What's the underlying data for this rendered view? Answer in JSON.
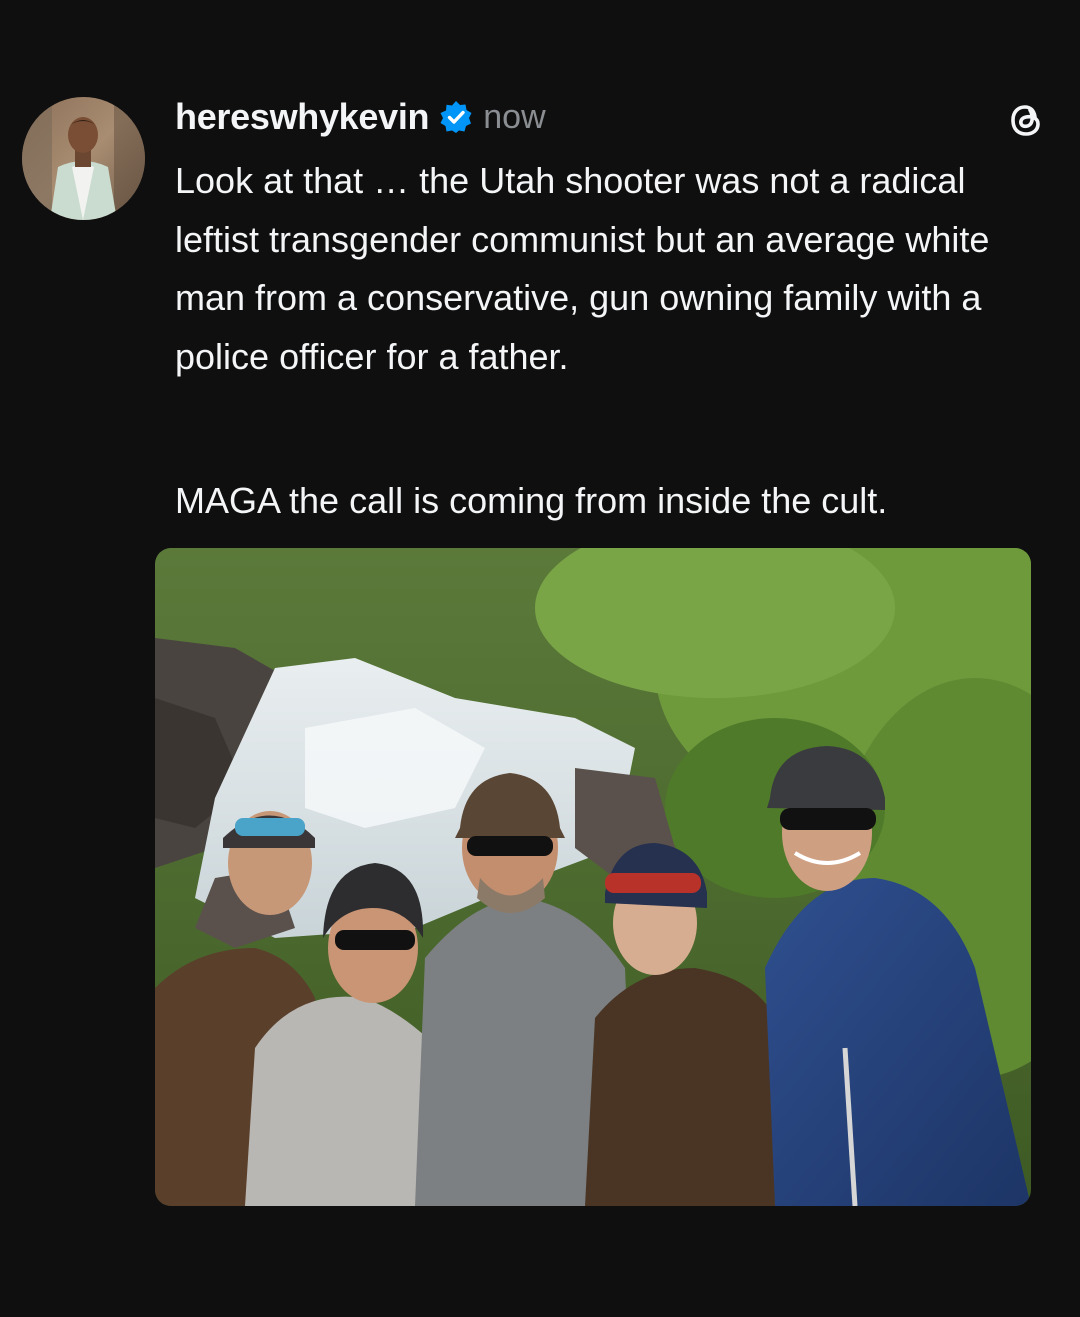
{
  "post": {
    "username": "hereswhykevin",
    "timestamp": "now",
    "paragraph1": "Look at that … the Utah shooter was not a radical leftist transgender communist but an average white man from a conservative, gun owning family with a police officer for a father.",
    "paragraph2": "MAGA the call is coming from inside the cult.",
    "verified": true
  },
  "icons": {
    "verified": "verified-badge-icon",
    "app": "threads-logo-icon"
  },
  "colors": {
    "background": "#0f0f0f",
    "text": "#f3f5f7",
    "muted": "#8a8d91",
    "verified_blue": "#0095f6"
  }
}
